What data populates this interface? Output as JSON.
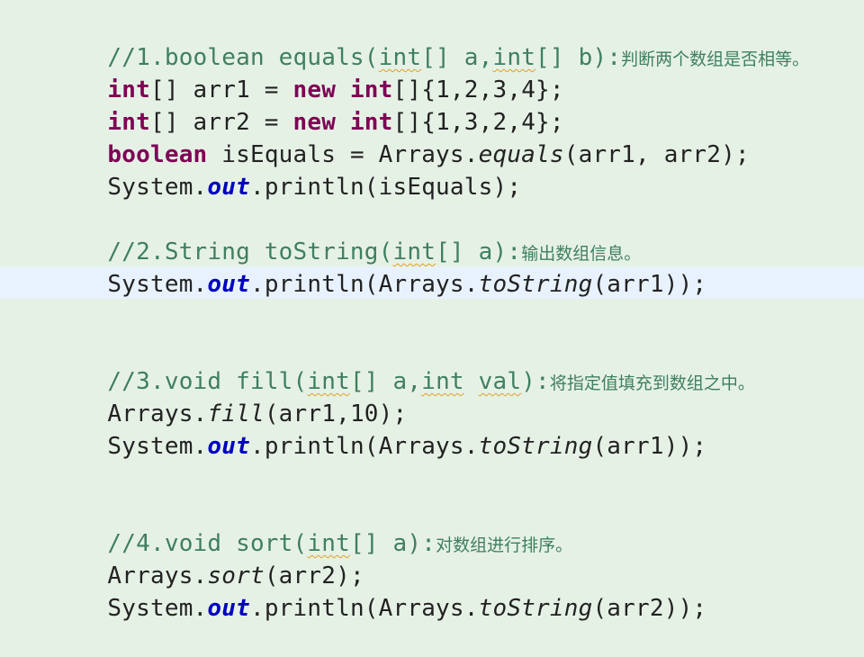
{
  "editor": {
    "lines": [
      {
        "parts": [
          "//1.boolean equals(",
          "int",
          "[] a,",
          "int",
          "[] b):",
          "判断两个数组是否相等。"
        ]
      },
      {
        "parts": [
          "int",
          "[] arr1 = ",
          "new",
          " ",
          "int",
          "[]{1,2,3,4};"
        ]
      },
      {
        "parts": [
          "int",
          "[] arr2 = ",
          "new",
          " ",
          "int",
          "[]{1,3,2,4};"
        ]
      },
      {
        "parts": [
          "boolean",
          " isEquals = Arrays.",
          "equals",
          "(arr1, arr2);"
        ]
      },
      {
        "parts": [
          "System.",
          "out",
          ".println(isEquals);"
        ]
      },
      {
        "parts": [
          "//2.String toString(",
          "int",
          "[] a):",
          "输出数组信息。"
        ]
      },
      {
        "parts": [
          "System.",
          "out",
          ".println(Arrays.",
          "toString",
          "(arr1));"
        ]
      },
      {
        "parts": [
          "//3.void fill(",
          "int",
          "[] a,",
          "int",
          " ",
          "val",
          "):",
          "将指定值填充到数组之中。"
        ]
      },
      {
        "parts": [
          "Arrays.",
          "fill",
          "(arr1,10);"
        ]
      },
      {
        "parts": [
          "System.",
          "out",
          ".println(Arrays.",
          "toString",
          "(arr1));"
        ]
      },
      {
        "parts": [
          "//4.void sort(",
          "int",
          "[] a):",
          "对数组进行排序。"
        ]
      },
      {
        "parts": [
          "Arrays.",
          "sort",
          "(arr2);"
        ]
      },
      {
        "parts": [
          "System.",
          "out",
          ".println(Arrays.",
          "toString",
          "(arr2));"
        ]
      }
    ]
  }
}
